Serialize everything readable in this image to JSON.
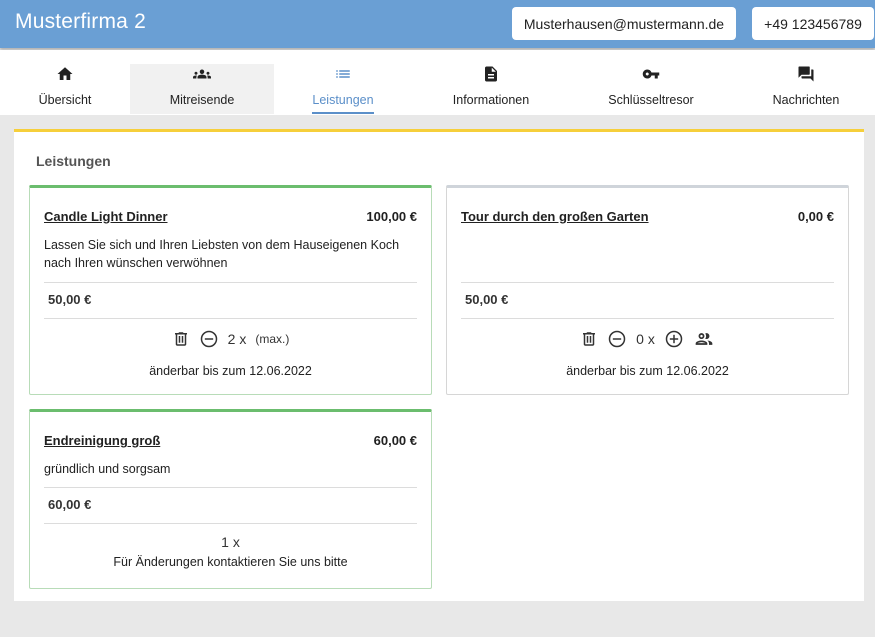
{
  "header": {
    "brand": "Musterfirma 2",
    "email": "Musterhausen@mustermann.de",
    "phone": "+49 123456789"
  },
  "nav": {
    "tabs": [
      {
        "label": "Übersicht",
        "icon": "home-icon"
      },
      {
        "label": "Mitreisende",
        "icon": "group-icon"
      },
      {
        "label": "Leistungen",
        "icon": "list-icon",
        "selected": true
      },
      {
        "label": "Informationen",
        "icon": "document-icon"
      },
      {
        "label": "Schlüsseltresor",
        "icon": "key-icon"
      },
      {
        "label": "Nachrichten",
        "icon": "chat-icon"
      }
    ]
  },
  "section": {
    "title": "Leistungen"
  },
  "colors": {
    "header": "#6a9fd4",
    "accent": "#5b8fc9",
    "panel_top": "#f6cf3b",
    "card_active": "#6bbd6e"
  },
  "cards": [
    {
      "title": "Candle Light Dinner",
      "price": "100,00 €",
      "description": "Lassen Sie sich und Ihren Liebsten von dem Hauseigenen Koch nach Ihren wünschen verwöhnen",
      "unit_price": "50,00 €",
      "quantity": "2 x",
      "max_label": "(max.)",
      "footer": "änderbar bis zum 12.06.2022"
    },
    {
      "title": "Tour durch den großen Garten",
      "price": "0,00 €",
      "description": "",
      "unit_price": "50,00 €",
      "quantity": "0 x",
      "footer": "änderbar bis zum 12.06.2022"
    },
    {
      "title": "Endreinigung groß",
      "price": "60,00 €",
      "description": "gründlich und sorgsam",
      "unit_price": "60,00 €",
      "quantity": "1 x",
      "footer": "Für Änderungen kontaktieren Sie uns bitte"
    }
  ]
}
